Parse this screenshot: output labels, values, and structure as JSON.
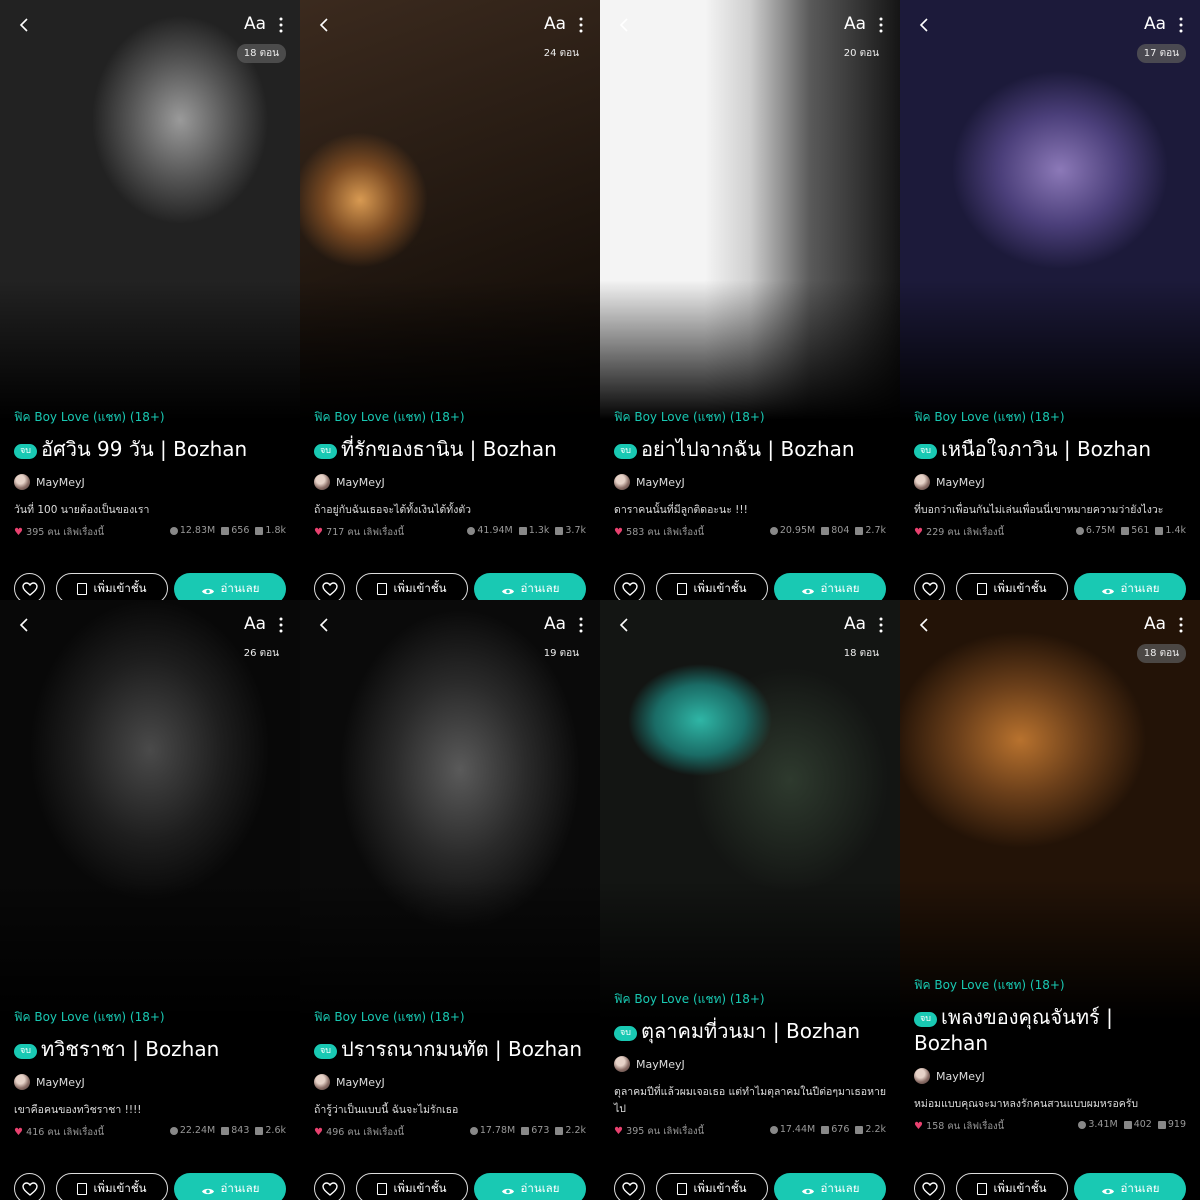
{
  "ui": {
    "category": "ฟิค Boy Love (แชท) (18+)",
    "end_badge": "จบ",
    "author": "MayMeyJ",
    "likes_suffix": "คน เลิฟเรื่องนี้",
    "shelf_label": "เพิ่มเข้าชั้น",
    "read_label": "อ่านเลย",
    "font_size_label": "Aa",
    "accent": "#19c9b3",
    "heart_color": "#e8416f"
  },
  "stories": [
    {
      "episodes": "18 ตอน",
      "title": "อัศวิน 99 วัน | Bozhan",
      "description": "วันที่ 100 นายต้องเป็นของเรา",
      "likes": "395",
      "views": "12.83M",
      "comments": "656",
      "saves": "1.8k"
    },
    {
      "episodes": "24 ตอน",
      "title": "ที่รักของธานิน | Bozhan",
      "description": "ถ้าอยู่กับฉันเธอจะได้ทั้งเงินได้ทั้งตัว",
      "likes": "717",
      "views": "41.94M",
      "comments": "1.3k",
      "saves": "3.7k"
    },
    {
      "episodes": "20 ตอน",
      "title": "อย่าไปจากฉัน | Bozhan",
      "description": "ดาราคนนั้นที่มีลูกติดอะนะ !!!",
      "likes": "583",
      "views": "20.95M",
      "comments": "804",
      "saves": "2.7k"
    },
    {
      "episodes": "17 ตอน",
      "title": "เหนือใจภาวิน | Bozhan",
      "description": "ที่บอกว่าเพื่อนกันไม่เล่นเพื่อนนี่เขาหมายความว่ายังไงวะ",
      "likes": "229",
      "views": "6.75M",
      "comments": "561",
      "saves": "1.4k"
    },
    {
      "episodes": "26 ตอน",
      "title": "ทวิชราชา | Bozhan",
      "description": "เขาคือคนของทวิชราชา !!!!",
      "likes": "416",
      "views": "22.24M",
      "comments": "843",
      "saves": "2.6k"
    },
    {
      "episodes": "19 ตอน",
      "title": "ปรารถนากมนทัต | Bozhan",
      "description": "ถ้ารู้ว่าเป็นแบบนี้ ฉันจะไม่รักเธอ",
      "likes": "496",
      "views": "17.78M",
      "comments": "673",
      "saves": "2.2k"
    },
    {
      "episodes": "18 ตอน",
      "title": "ตุลาคมที่วนมา | Bozhan",
      "description": "ตุลาคมปีที่แล้วผมเจอเธอ แต่ทำไมตุลาคมในปีต่อๆมาเธอหายไป",
      "likes": "395",
      "views": "17.44M",
      "comments": "676",
      "saves": "2.2k"
    },
    {
      "episodes": "18 ตอน",
      "title": "เพลงของคุณจันทร์ | Bozhan",
      "description": "หม่อมแบบคุณจะมาหลงรักคนสวนแบบผมหรอครับ",
      "likes": "158",
      "views": "3.41M",
      "comments": "402",
      "saves": "919"
    }
  ]
}
